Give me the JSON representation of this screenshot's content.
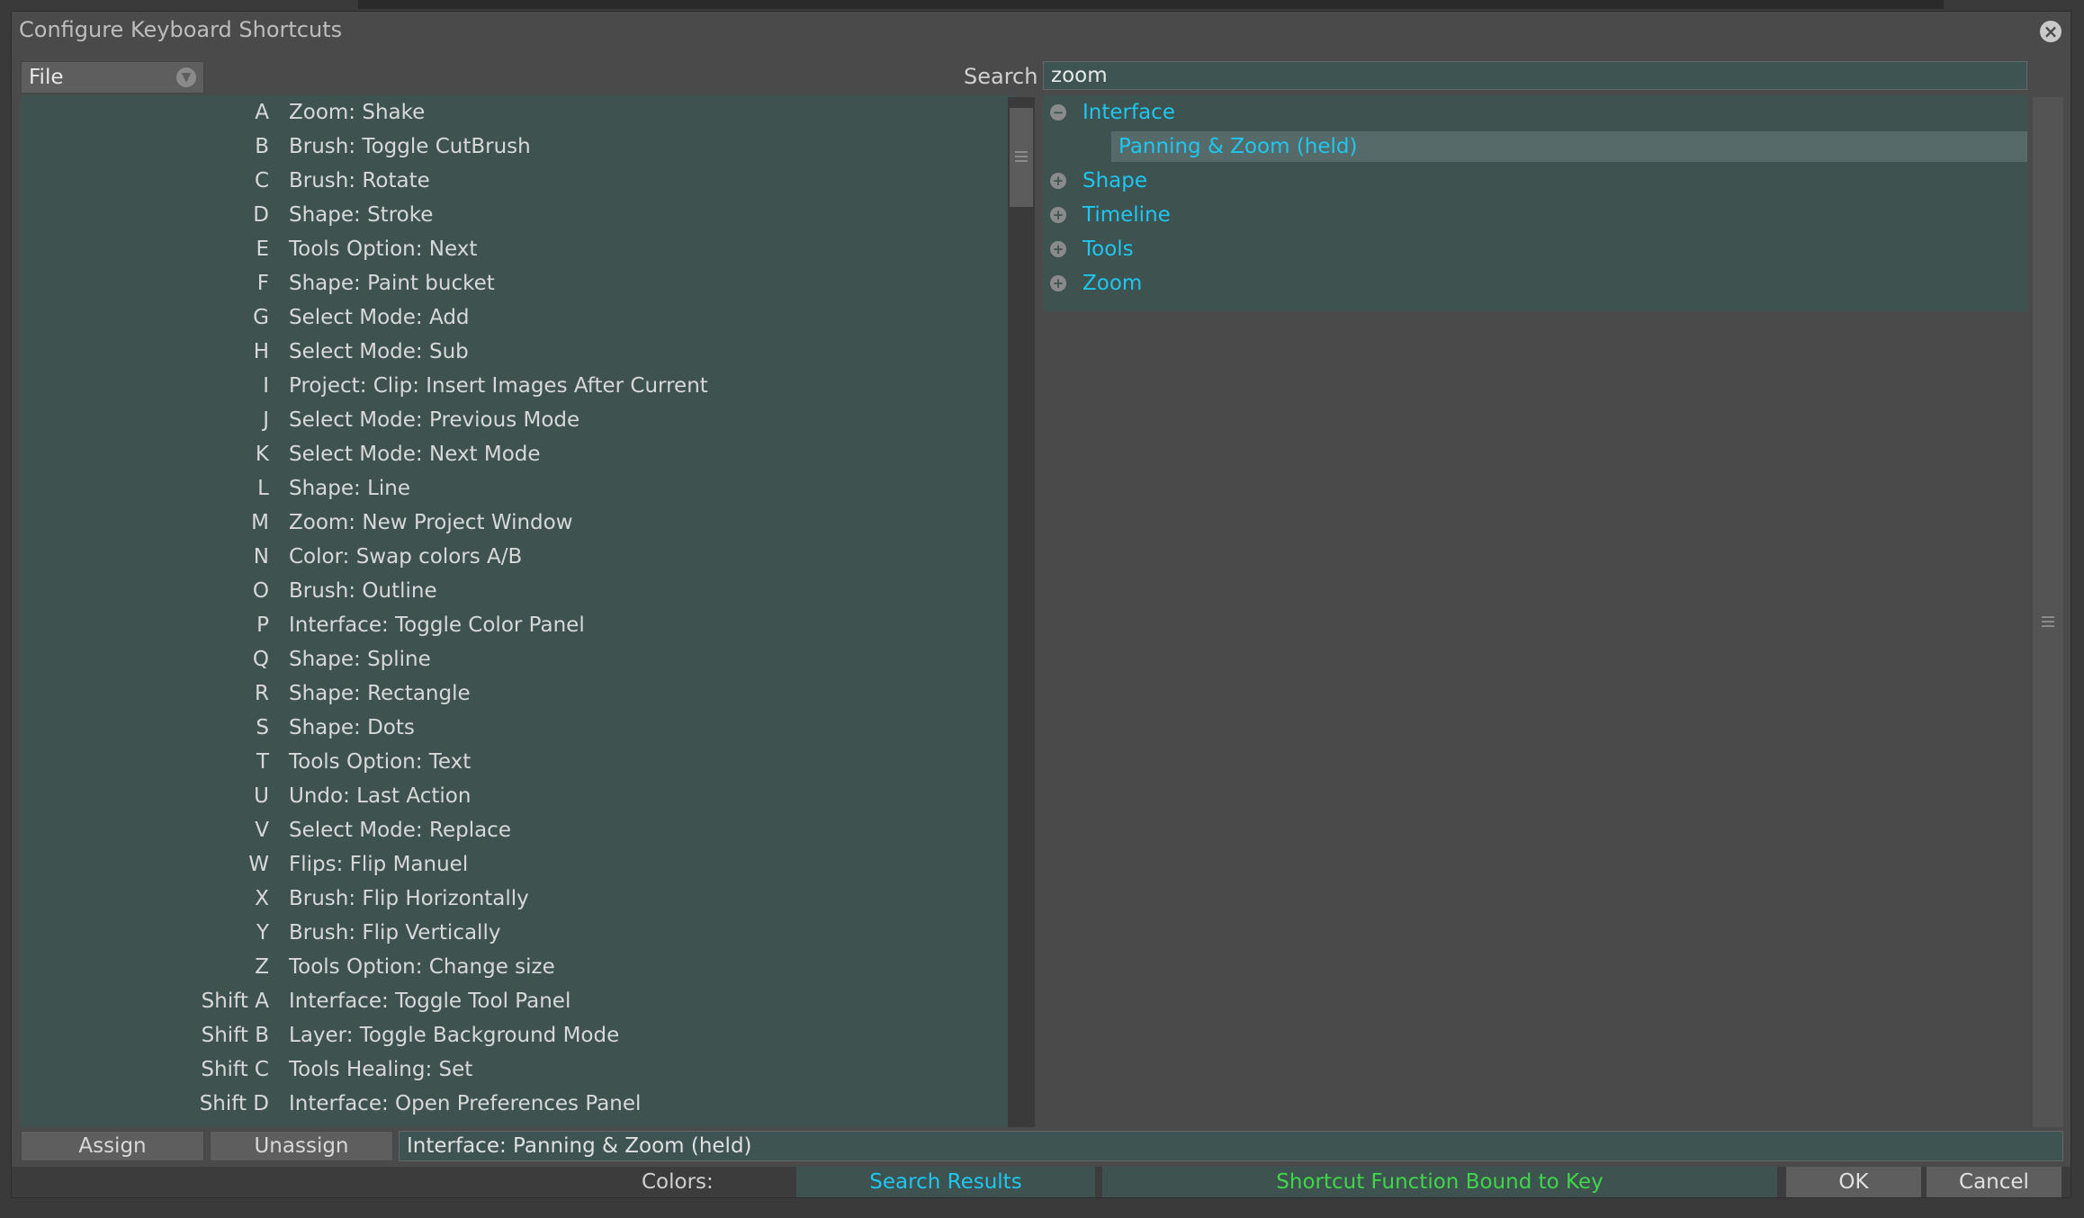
{
  "window": {
    "title": "Configure Keyboard Shortcuts"
  },
  "filter": {
    "selected": "File"
  },
  "search": {
    "label": "Search",
    "value": "zoom"
  },
  "shortcuts": [
    {
      "key": "A",
      "func": "Zoom: Shake"
    },
    {
      "key": "B",
      "func": "Brush: Toggle CutBrush"
    },
    {
      "key": "C",
      "func": "Brush: Rotate"
    },
    {
      "key": "D",
      "func": "Shape: Stroke"
    },
    {
      "key": "E",
      "func": "Tools Option: Next"
    },
    {
      "key": "F",
      "func": "Shape: Paint bucket"
    },
    {
      "key": "G",
      "func": "Select Mode: Add"
    },
    {
      "key": "H",
      "func": "Select Mode: Sub"
    },
    {
      "key": "I",
      "func": "Project: Clip: Insert Images After Current"
    },
    {
      "key": "J",
      "func": "Select Mode: Previous Mode"
    },
    {
      "key": "K",
      "func": "Select Mode: Next Mode"
    },
    {
      "key": "L",
      "func": "Shape: Line"
    },
    {
      "key": "M",
      "func": "Zoom: New Project Window"
    },
    {
      "key": "N",
      "func": "Color: Swap colors A/B"
    },
    {
      "key": "O",
      "func": "Brush: Outline"
    },
    {
      "key": "P",
      "func": "Interface: Toggle Color Panel"
    },
    {
      "key": "Q",
      "func": "Shape: Spline"
    },
    {
      "key": "R",
      "func": "Shape: Rectangle"
    },
    {
      "key": "S",
      "func": "Shape: Dots"
    },
    {
      "key": "T",
      "func": "Tools Option: Text"
    },
    {
      "key": "U",
      "func": "Undo: Last Action"
    },
    {
      "key": "V",
      "func": "Select Mode: Replace"
    },
    {
      "key": "W",
      "func": "Flips: Flip Manuel"
    },
    {
      "key": "X",
      "func": "Brush: Flip Horizontally"
    },
    {
      "key": "Y",
      "func": "Brush: Flip Vertically"
    },
    {
      "key": "Z",
      "func": "Tools Option: Change size"
    },
    {
      "key": "Shift A",
      "func": "Interface: Toggle Tool Panel"
    },
    {
      "key": "Shift B",
      "func": "Layer: Toggle Background Mode"
    },
    {
      "key": "Shift C",
      "func": "Tools Healing: Set"
    },
    {
      "key": "Shift D",
      "func": "Interface: Open Preferences Panel"
    }
  ],
  "tree": [
    {
      "label": "Interface",
      "expander": "−",
      "child": false
    },
    {
      "label": "Panning & Zoom (held)",
      "expander": "",
      "child": true
    },
    {
      "label": "Shape",
      "expander": "+",
      "child": false
    },
    {
      "label": "Timeline",
      "expander": "+",
      "child": false
    },
    {
      "label": "Tools",
      "expander": "+",
      "child": false
    },
    {
      "label": "Zoom",
      "expander": "+",
      "child": false
    }
  ],
  "actions": {
    "assign": "Assign",
    "unassign": "Unassign"
  },
  "assigned_function": "Interface: Panning & Zoom (held)",
  "footer": {
    "colors_label": "Colors:",
    "search_results": "Search Results",
    "bound": "Shortcut Function Bound to Key",
    "ok": "OK",
    "cancel": "Cancel"
  },
  "colors": {
    "search_result": "#1fc6ef",
    "bound": "#3fd64a",
    "panel": "#3e5250"
  }
}
